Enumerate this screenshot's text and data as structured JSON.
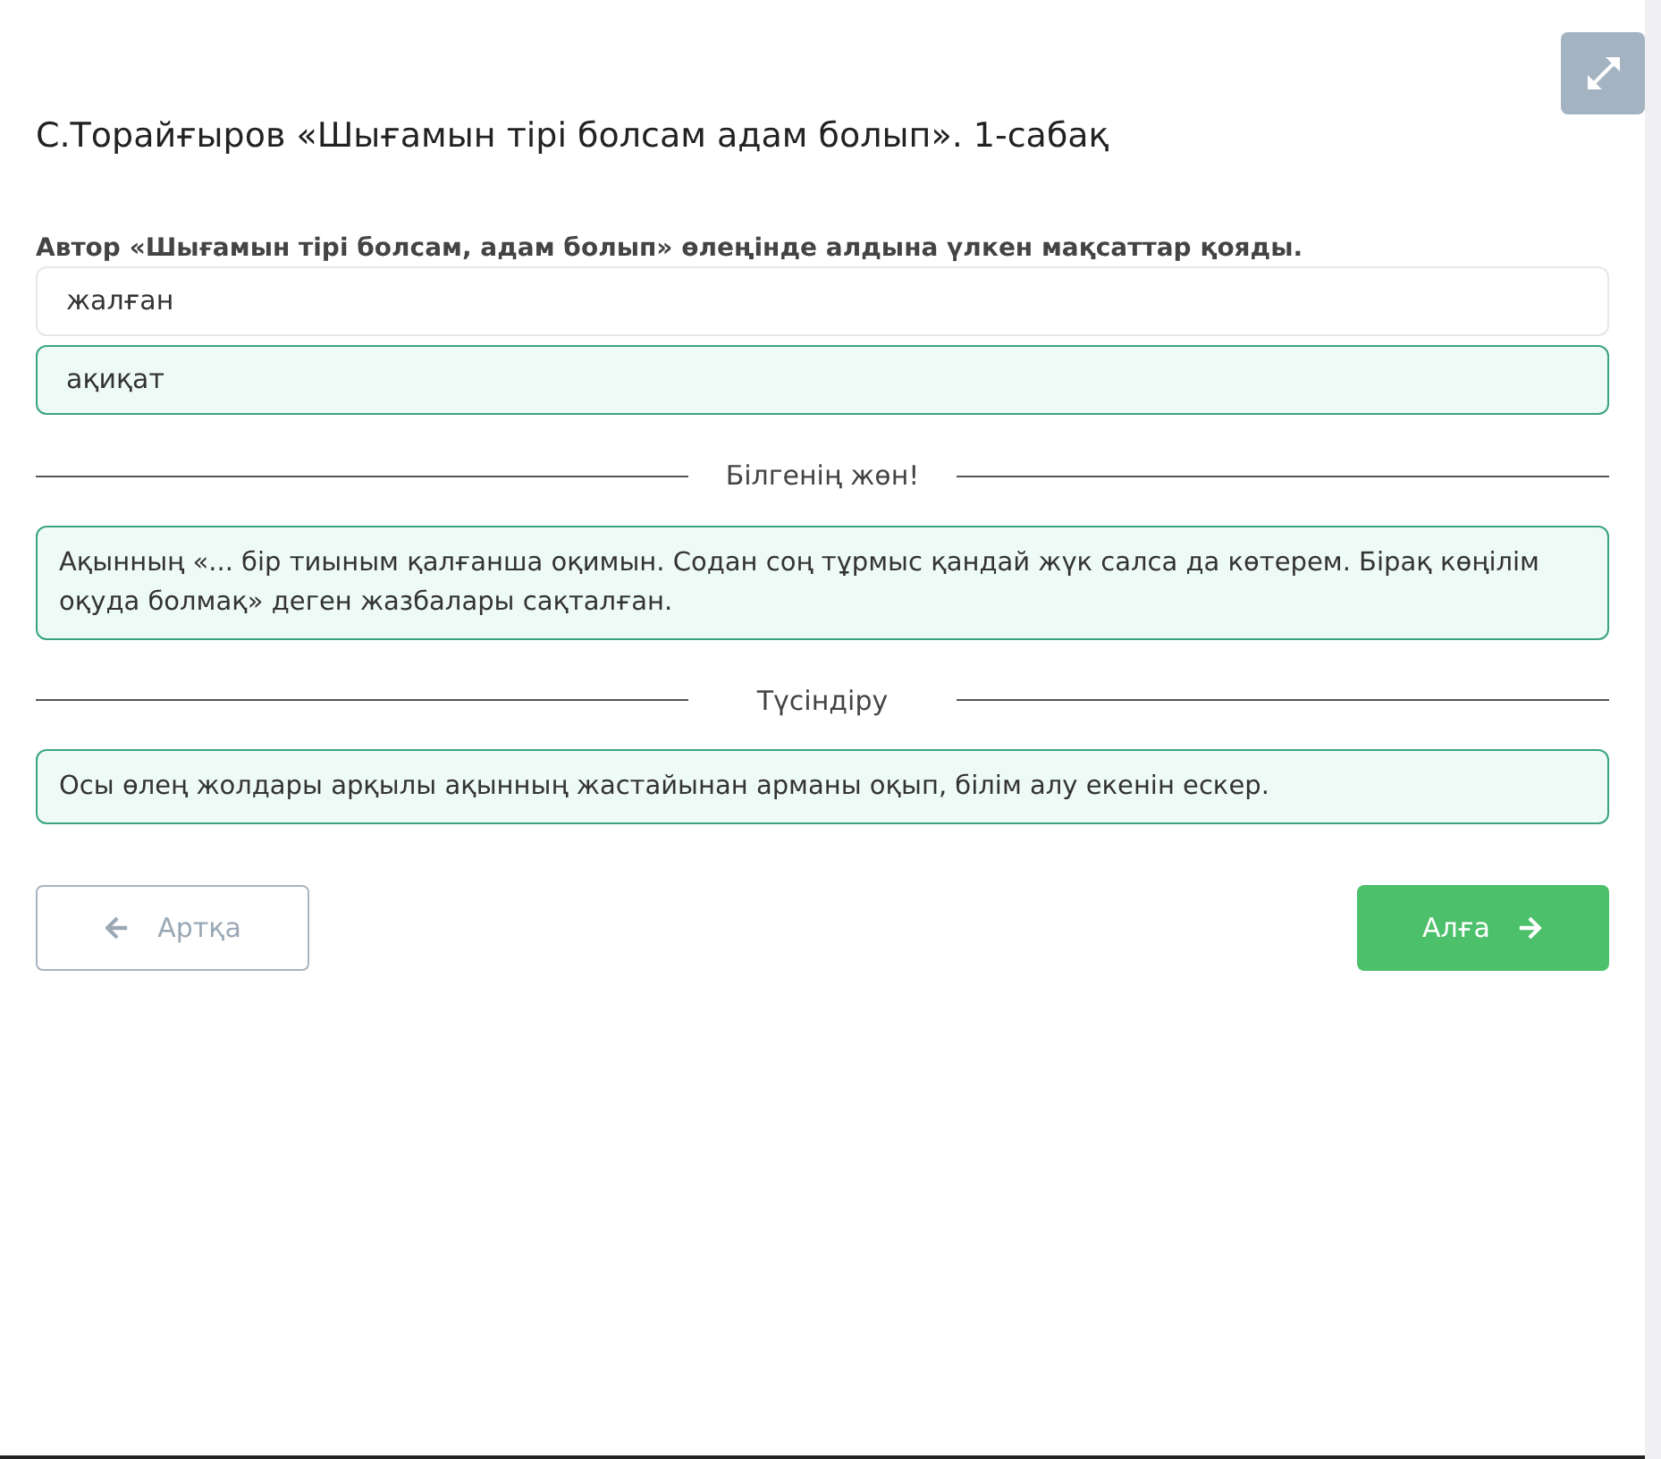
{
  "title": "С.Торайғыров «Шығамын тірі болсам адам болып». 1-сабақ",
  "question": {
    "text": "Автор «Шығамын тірі болсам, адам болып» өлеңінде алдына үлкен мақсаттар қояды.",
    "options": [
      {
        "label": "жалған",
        "selected": false
      },
      {
        "label": "ақиқат",
        "selected": true
      }
    ]
  },
  "sections": [
    {
      "heading": "Білгенің жөн!",
      "text": "Ақынның «... бір тиыным қалғанша оқимын. Содан соң тұрмыс қандай жүк салса да көтерем. Бірақ көңілім оқуда болмақ» деген жазбалары сақталған."
    },
    {
      "heading": "Түсіндіру",
      "text": "Осы өлең жолдары арқылы ақынның жастайынан арманы оқып, білім алу екенін ескер."
    }
  ],
  "buttons": [
    {
      "label": "Артқа",
      "kind": "back",
      "disabled": true
    },
    {
      "label": "Алға",
      "kind": "next",
      "disabled": false
    }
  ]
}
